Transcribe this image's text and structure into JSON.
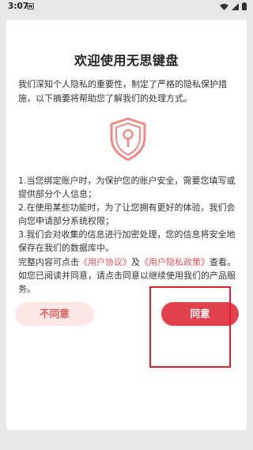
{
  "status_bar": {
    "time": "3:07",
    "icons": [
      "notification-icon",
      "wifi-icon",
      "signal-icon",
      "battery-icon"
    ]
  },
  "dialog": {
    "title": "欢迎使用无思键盘",
    "intro": "我们深知个人隐私的重要性，制定了严格的隐私保护措施，以下摘要将帮助您了解我们的处理方式。",
    "icon": "shield-lock-icon",
    "items": [
      "1.当您绑定账户时，为保护您的账户安全，需要您填写或提供部分个人信息；",
      "2.在使用某些功能时，为了让您拥有更好的体验，我们会向您申请部分系统权限；",
      "3.我们会对收集的信息进行加密处理，您的信息将安全地保存在我们的数据库中。"
    ],
    "consent": {
      "prefix": "完整内容可点击",
      "user_agreement": "《用户协议》",
      "and": "及",
      "privacy_policy": "《用户隐私政策》",
      "suffix": "查看。如您已阅读并同意，请点击同意以继续使用我们的产品服务。"
    },
    "decline_label": "不同意",
    "agree_label": "同意"
  },
  "colors": {
    "accent": "#e0414a",
    "decline_bg": "#fde8e6",
    "shield": "#f08a86",
    "highlight": "#e0202a"
  }
}
